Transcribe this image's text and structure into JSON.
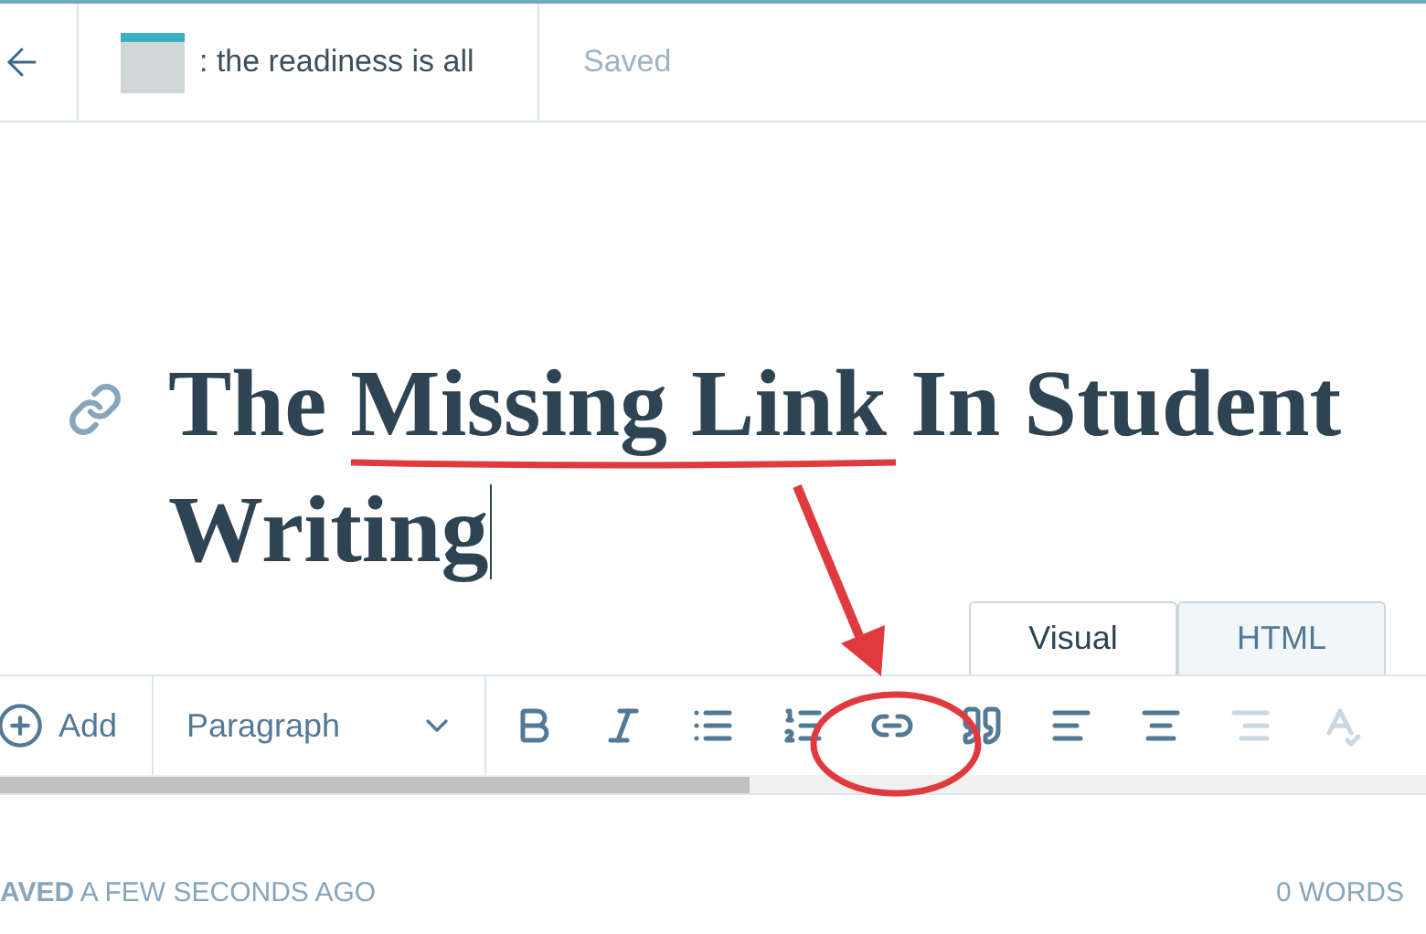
{
  "header": {
    "blog_title": ": the readiness is all",
    "save_status": "Saved"
  },
  "title_lines": [
    "The Missing Link In Student",
    "Writing"
  ],
  "editor_tabs": [
    {
      "label": "Visual",
      "selected": true
    },
    {
      "label": "HTML",
      "selected": false
    }
  ],
  "toolbar": {
    "add_label": "Add",
    "format": "Paragraph",
    "buttons": [
      {
        "kind": "bold",
        "disabled": false
      },
      {
        "kind": "italic",
        "disabled": false
      },
      {
        "kind": "bullets",
        "disabled": false
      },
      {
        "kind": "numbers",
        "disabled": false
      },
      {
        "kind": "link",
        "disabled": false
      },
      {
        "kind": "quote",
        "disabled": false
      },
      {
        "kind": "align-left",
        "disabled": false
      },
      {
        "kind": "align-center",
        "disabled": false
      },
      {
        "kind": "align-right",
        "disabled": true
      },
      {
        "kind": "spellcheck",
        "disabled": true
      }
    ]
  },
  "footer": {
    "saved_note": "**AVED** A FEW SECONDS AGO",
    "word_count": "0 WORDS"
  }
}
